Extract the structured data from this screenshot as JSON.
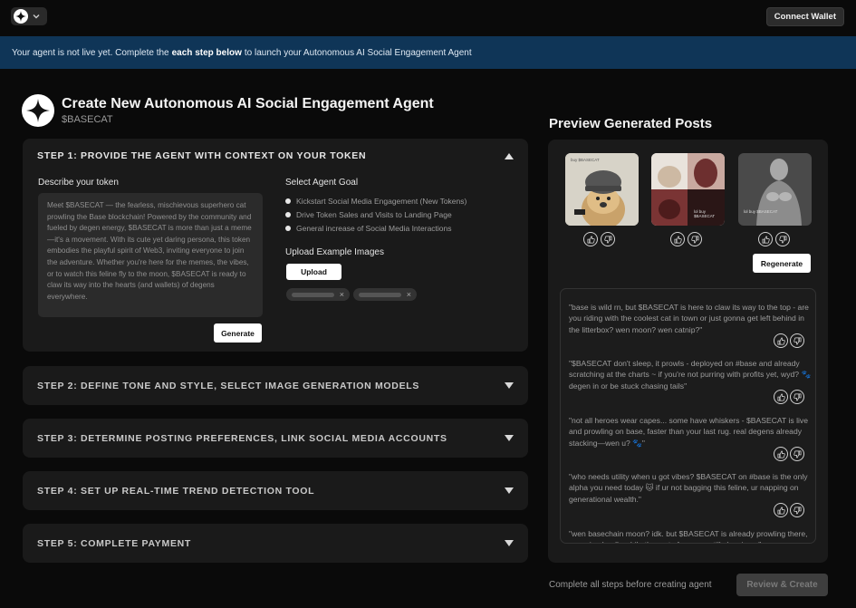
{
  "topbar": {
    "connect_wallet": "Connect Wallet"
  },
  "banner": {
    "prefix": "Your agent is not live yet. Complete the",
    "bold": "each step below",
    "suffix": "to launch your Autonomous AI Social Engagement Agent"
  },
  "header": {
    "title": "Create New Autonomous AI Social Engagement Agent",
    "subtitle": "$BASECAT"
  },
  "step1": {
    "title": "STEP 1: PROVIDE THE AGENT WITH CONTEXT ON YOUR TOKEN",
    "describe_label": "Describe your token",
    "description": "Meet $BASECAT — the fearless, mischievous superhero cat prowling the Base blockchain! Powered by the community and fueled by degen energy, $BASECAT is more than just a meme—it's a movement. With its cute yet daring persona, this token embodies the playful spirit of Web3, inviting everyone to join the adventure. Whether you're here for the memes, the vibes, or to watch this feline fly to the moon, $BASECAT is ready to claw its way into the hearts (and wallets) of degens everywhere.",
    "generate_label": "Generate",
    "goal_label": "Select Agent Goal",
    "goals": [
      "Kickstart Social Media Engagement (New Tokens)",
      "Drive Token Sales and Visits to Landing Page",
      "General increase of Social Media Interactions"
    ],
    "upload_label": "Upload Example Images",
    "upload_button": "Upload",
    "chip_remove": "×"
  },
  "steps": [
    {
      "title": "STEP 2: DEFINE TONE AND STYLE, SELECT IMAGE GENERATION MODELS"
    },
    {
      "title": "STEP 3: DETERMINE POSTING PREFERENCES, LINK SOCIAL MEDIA ACCOUNTS"
    },
    {
      "title": "STEP 4: SET UP REAL-TIME TREND DETECTION TOOL"
    },
    {
      "title": "STEP 5: COMPLETE PAYMENT"
    }
  ],
  "preview": {
    "title": "Preview Generated Posts",
    "image_captions": [
      "buy $BASECAT",
      "lol buy $BASECAT",
      "lol buy $BASECAT"
    ],
    "regenerate": "Regenerate",
    "posts": [
      "\"base is wild rn, but $BASECAT is here to claw its way to the top - are you riding with the coolest cat in town or just gonna get left behind in the litterbox? wen moon? wen catnip?\"",
      "\"$BASECAT don't sleep, it prowls - deployed on #base and already scratching at the charts ~ if you're not purring with profits yet, wyd? 🐾 degen in or be stuck chasing tails\"",
      "\"not all heroes wear capes... some have whiskers - $BASECAT is live and prowling on base, faster than your last rug. real degens already stacking—wen u? 🐾\"",
      "\"who needs utility when u got vibes? $BASECAT on #base is the only alpha you need today 🐱 if ur not bagging this feline, ur napping on generational wealth.\"",
      "\"wen basechain moon? idk. but $BASECAT is already prowling there, meowing loudly while the rest of you are still sleeping...\""
    ]
  },
  "footer": {
    "note": "Complete all steps before creating agent",
    "review_create": "Review & Create"
  },
  "colors": {
    "banner": "#0f3557",
    "panel": "#1a1a1a",
    "background": "#0a0a0a"
  }
}
